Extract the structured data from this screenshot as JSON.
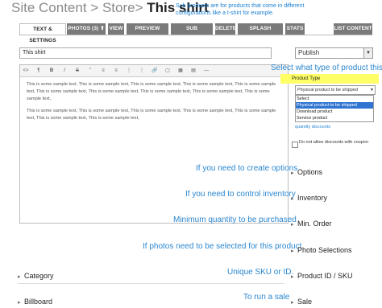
{
  "breadcrumb": {
    "part1": "Site Content",
    "sep1": " > ",
    "part2": "Store",
    "sep2": "> ",
    "current": "This shirt"
  },
  "subproduct_note": "Sub products are for products that come in different configurations like a t-shirt for example.",
  "tabs": [
    {
      "label": "TEXT & SETTINGS"
    },
    {
      "label": "PHOTOS (3) ⬆"
    },
    {
      "label": "VIEW"
    },
    {
      "label": "PREVIEW PHOTO"
    },
    {
      "label": "SUB PRODUCTS"
    },
    {
      "label": "DELETE"
    },
    {
      "label": "SPLASH WINDOW"
    },
    {
      "label": "STATS"
    }
  ],
  "list_content_button": "LIST CONTENT",
  "title_input": {
    "value": "This shirt"
  },
  "publish_select": {
    "value": "Publish"
  },
  "editor": {
    "toolbar_icons": [
      "<>",
      "¶",
      "B",
      "I",
      "S",
      "\"",
      "≡",
      "≡",
      "⋮",
      "⋮",
      "🔗",
      "▢",
      "▦",
      "▤",
      "—"
    ],
    "paragraph1": "This is some sample text, This is some sample text, This is some sample text, This is some sample text, This is some sample text, This is some sample text, This is some sample text, This is some sample text, This is some sample text, This is some sample text,",
    "paragraph2": "This is some sample text, This is some sample text, This is some sample text, This is some sample text, This is some sample text, This is some sample text, This is some sample text,"
  },
  "product_type": {
    "annotation": "Select what type of product this is",
    "label": "Product Type",
    "selected": "Physical product to be shipped",
    "options": [
      "Select",
      "Physical product to be shipped",
      "Download product",
      "Service product"
    ]
  },
  "quantity_discounts_link": "quantity discounts",
  "no_discount_checkbox_label": "Do not allow discounts with coupon",
  "sections": [
    {
      "annotation": "If you need to create options",
      "label": "Options"
    },
    {
      "annotation": "If you need to control inventory",
      "label": "Inventory"
    },
    {
      "annotation": "Minimum quantity to be purchased",
      "label": "Min. Order"
    },
    {
      "annotation": "If photos need to be selected for this product",
      "label": "Photo Selections"
    },
    {
      "annotation": "Unique SKU or ID.",
      "label": "Product ID / SKU"
    },
    {
      "annotation": "To run a sale",
      "label": "Sale"
    }
  ],
  "left_sections": [
    {
      "label": "Category"
    },
    {
      "label": "Billboard"
    }
  ],
  "colors": {
    "annotation": "#2a86cf",
    "highlight": "#ffff66",
    "tab_bg": "#7a7a7a",
    "selected_option": "#2f74d0"
  }
}
